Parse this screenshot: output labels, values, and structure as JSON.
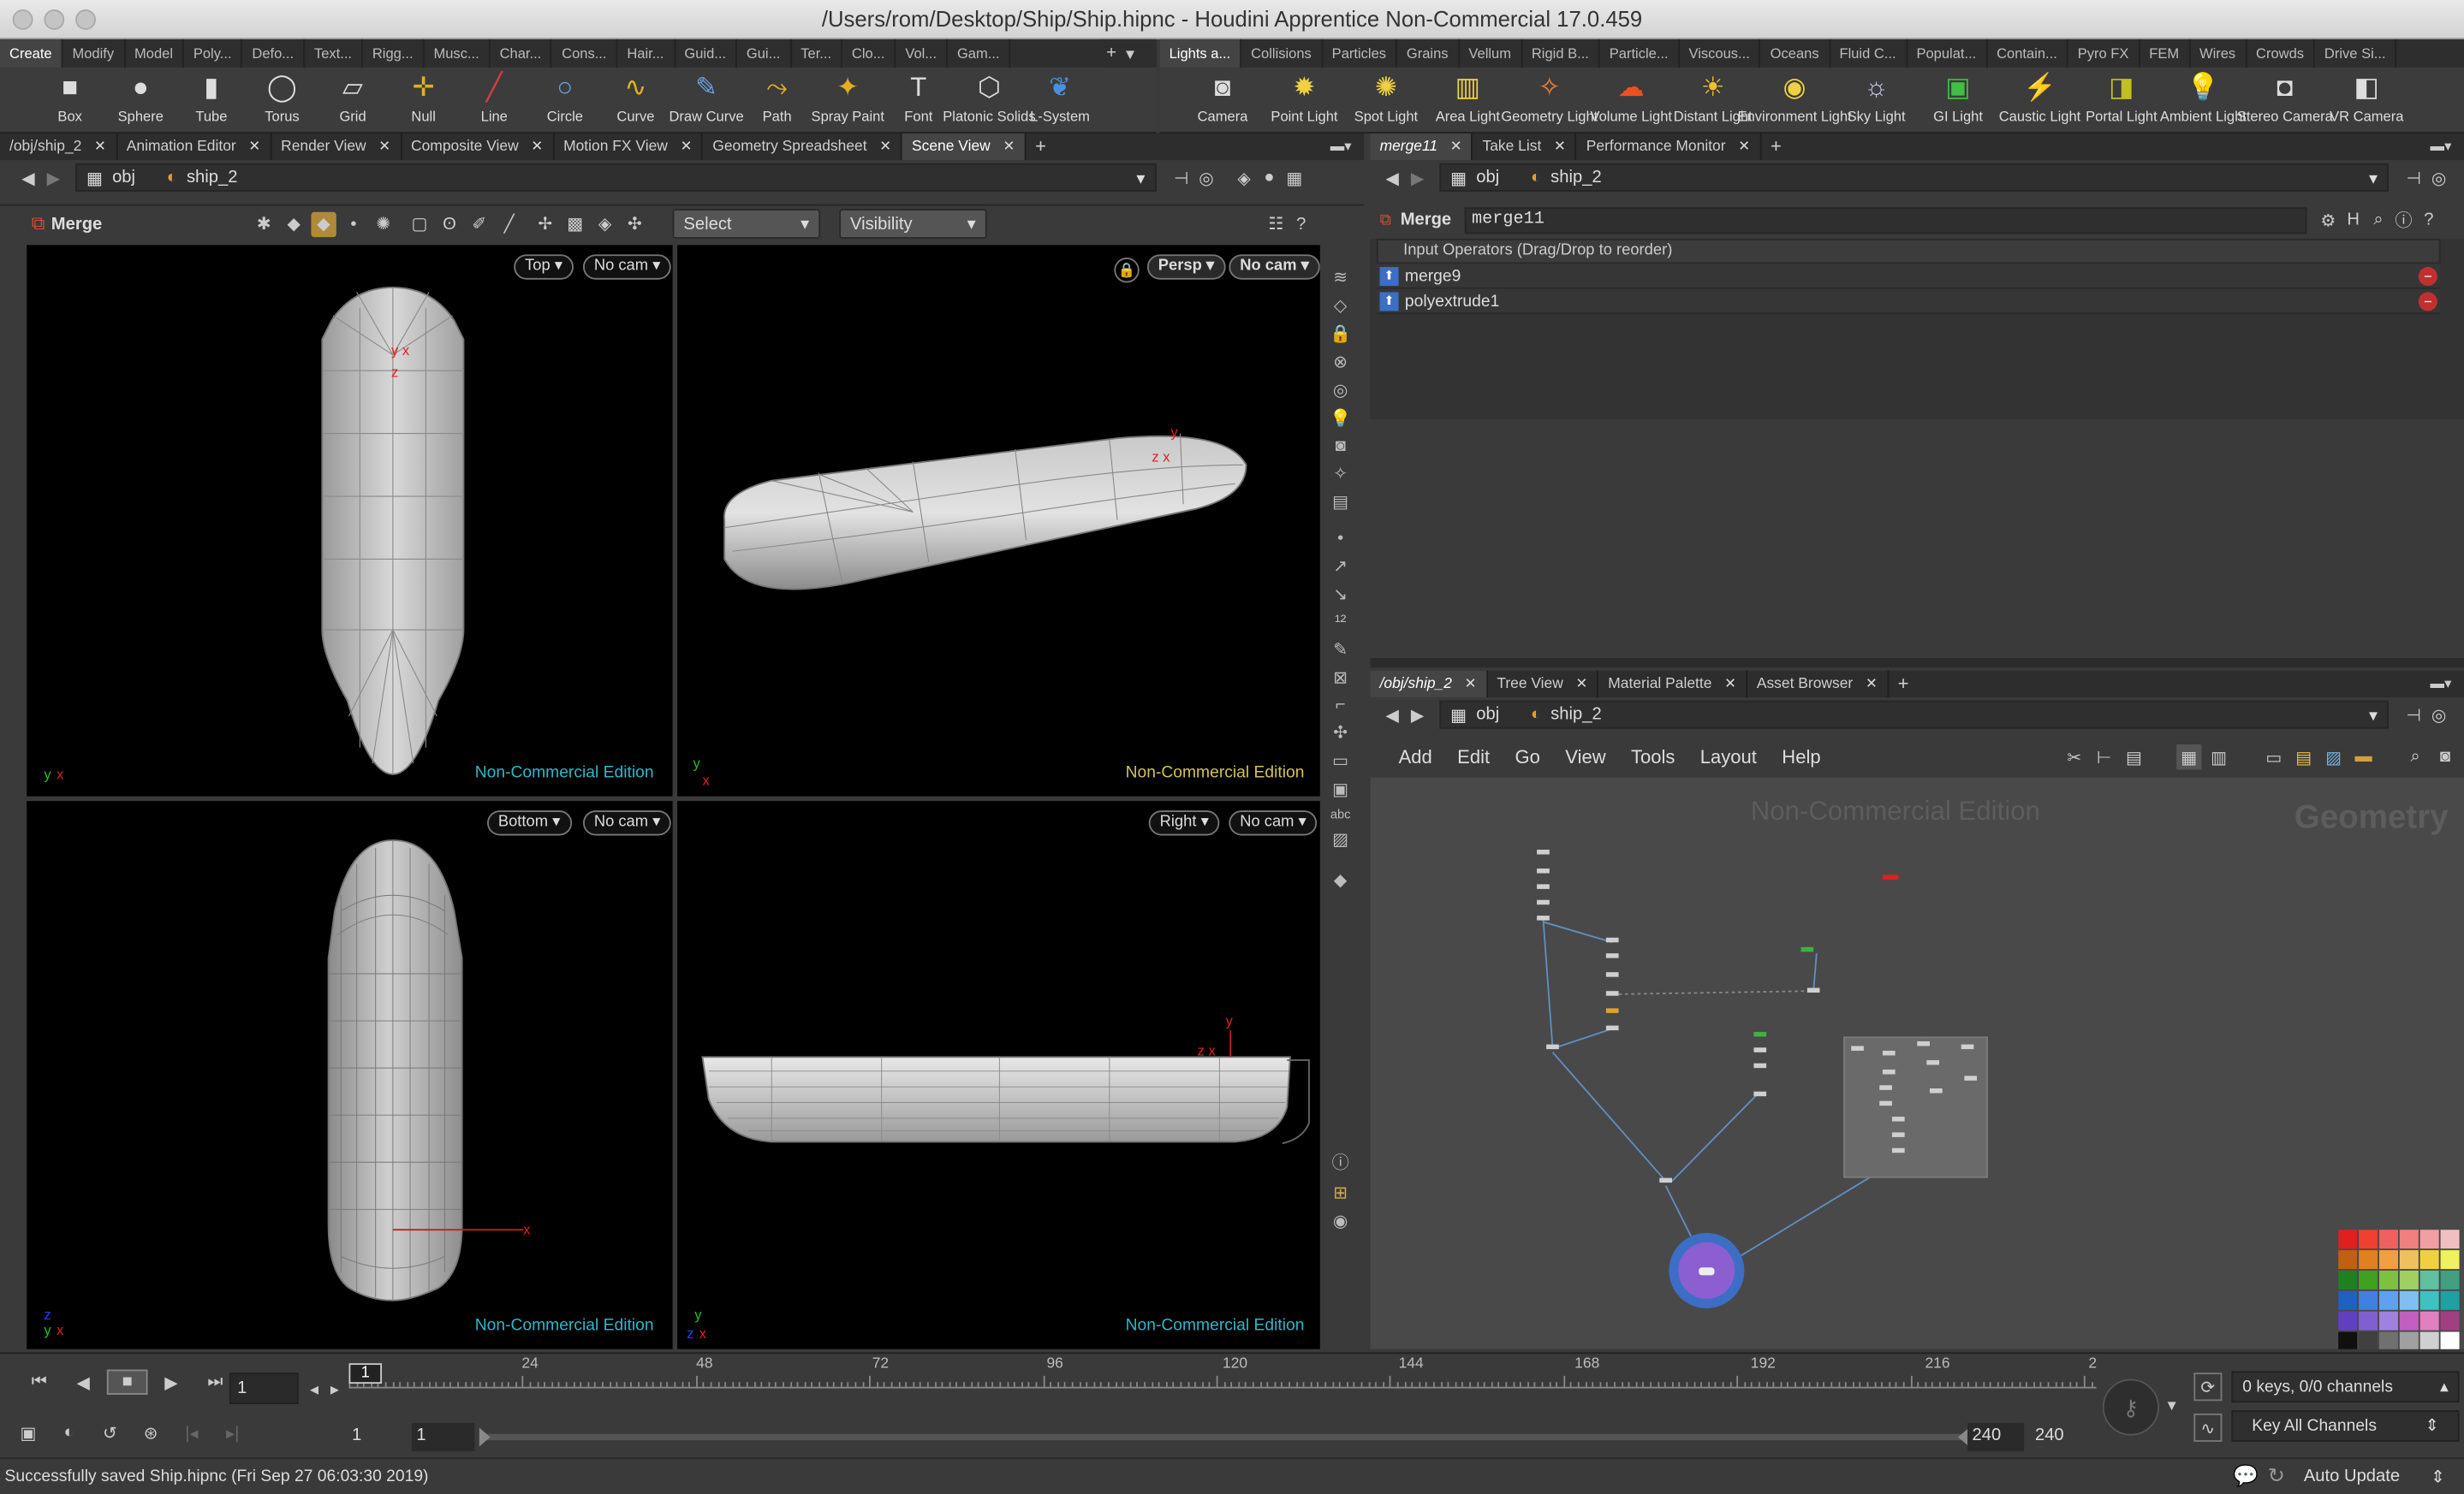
{
  "window": {
    "title": "/Users/rom/Desktop/Ship/Ship.hipnc - Houdini Apprentice Non-Commercial 17.0.459"
  },
  "shelf_left": {
    "tabs": [
      "Create",
      "Modify",
      "Model",
      "Poly...",
      "Defo...",
      "Text...",
      "Rigg...",
      "Musc...",
      "Char...",
      "Cons...",
      "Hair...",
      "Guid...",
      "Gui...",
      "Ter...",
      "Clo...",
      "Vol...",
      "Gam..."
    ],
    "active_tab": "Create",
    "tools": [
      {
        "label": "Box",
        "icon": "box-icon",
        "glyph": "■"
      },
      {
        "label": "Sphere",
        "icon": "sphere-icon",
        "glyph": "●"
      },
      {
        "label": "Tube",
        "icon": "tube-icon",
        "glyph": "▮"
      },
      {
        "label": "Torus",
        "icon": "torus-icon",
        "glyph": "◯"
      },
      {
        "label": "Grid",
        "icon": "grid-icon",
        "glyph": "▱"
      },
      {
        "label": "Null",
        "icon": "null-icon",
        "glyph": "✛"
      },
      {
        "label": "Line",
        "icon": "line-icon",
        "glyph": "╱"
      },
      {
        "label": "Circle",
        "icon": "circle-icon",
        "glyph": "○"
      },
      {
        "label": "Curve",
        "icon": "curve-icon",
        "glyph": "∿"
      },
      {
        "label": "Draw Curve",
        "icon": "draw-curve-icon",
        "glyph": "✎"
      },
      {
        "label": "Path",
        "icon": "path-icon",
        "glyph": "⤳"
      },
      {
        "label": "Spray Paint",
        "icon": "spray-paint-icon",
        "glyph": "✦"
      },
      {
        "label": "Font",
        "icon": "font-icon",
        "glyph": "T"
      },
      {
        "label": "Platonic Solids",
        "icon": "platonic-solids-icon",
        "glyph": "⬡"
      },
      {
        "label": "L-System",
        "icon": "l-system-icon",
        "glyph": "❦"
      }
    ]
  },
  "shelf_right": {
    "tabs": [
      "Lights a...",
      "Collisions",
      "Particles",
      "Grains",
      "Vellum",
      "Rigid B...",
      "Particle...",
      "Viscous...",
      "Oceans",
      "Fluid C...",
      "Populat...",
      "Contain...",
      "Pyro FX",
      "FEM",
      "Wires",
      "Crowds",
      "Drive Si..."
    ],
    "active_tab": "Lights a...",
    "tools": [
      {
        "label": "Camera",
        "icon": "camera-icon",
        "glyph": "◙"
      },
      {
        "label": "Point Light",
        "icon": "point-light-icon",
        "glyph": "✹"
      },
      {
        "label": "Spot Light",
        "icon": "spot-light-icon",
        "glyph": "✺"
      },
      {
        "label": "Area Light",
        "icon": "area-light-icon",
        "glyph": "▥"
      },
      {
        "label": "Geometry Light",
        "icon": "geometry-light-icon",
        "glyph": "✧"
      },
      {
        "label": "Volume Light",
        "icon": "volume-light-icon",
        "glyph": "☁"
      },
      {
        "label": "Distant Light",
        "icon": "distant-light-icon",
        "glyph": "☀"
      },
      {
        "label": "Environment Light",
        "icon": "environment-light-icon",
        "glyph": "◉"
      },
      {
        "label": "Sky Light",
        "icon": "sky-light-icon",
        "glyph": "☼"
      },
      {
        "label": "GI Light",
        "icon": "gi-light-icon",
        "glyph": "▣"
      },
      {
        "label": "Caustic Light",
        "icon": "caustic-light-icon",
        "glyph": "⚡"
      },
      {
        "label": "Portal Light",
        "icon": "portal-light-icon",
        "glyph": "◨"
      },
      {
        "label": "Ambient Light",
        "icon": "ambient-light-icon",
        "glyph": "💡"
      },
      {
        "label": "Stereo Camera",
        "icon": "stereo-camera-icon",
        "glyph": "◘"
      },
      {
        "label": "VR Camera",
        "icon": "vr-camera-icon",
        "glyph": "◧"
      }
    ]
  },
  "left_pane": {
    "tabs": [
      "/obj/ship_2",
      "Animation Editor",
      "Render View",
      "Composite View",
      "Motion FX View",
      "Geometry Spreadsheet",
      "Scene View"
    ],
    "active_tab": "Scene View",
    "path": {
      "root": "obj",
      "node": "ship_2"
    },
    "toolbar": {
      "node_label": "Merge",
      "select_label": "Select",
      "visibility_label": "Visibility"
    },
    "viewports": [
      {
        "view": "Top",
        "cam": "No cam",
        "watermark": "Non-Commercial Edition"
      },
      {
        "view": "Persp",
        "cam": "No cam",
        "watermark": "Non-Commercial Edition"
      },
      {
        "view": "Bottom",
        "cam": "No cam",
        "watermark": "Non-Commercial Edition"
      },
      {
        "view": "Right",
        "cam": "No cam",
        "watermark": "Non-Commercial Edition"
      }
    ]
  },
  "param_pane": {
    "tabs": [
      "merge11",
      "Take List",
      "Performance Monitor"
    ],
    "active_tab": "merge11",
    "path": {
      "root": "obj",
      "node": "ship_2"
    },
    "node_type": "Merge",
    "node_name": "merge11",
    "input_header": "Input Operators (Drag/Drop to reorder)",
    "inputs": [
      "merge9",
      "polyextrude1"
    ]
  },
  "network_pane": {
    "tabs": [
      "/obj/ship_2",
      "Tree View",
      "Material Palette",
      "Asset Browser"
    ],
    "active_tab": "/obj/ship_2",
    "path": {
      "root": "obj",
      "node": "ship_2"
    },
    "menu": [
      "Add",
      "Edit",
      "Go",
      "View",
      "Tools",
      "Layout",
      "Help"
    ],
    "watermark": "Non-Commercial Edition",
    "context_label": "Geometry"
  },
  "timeline": {
    "current_frame": "1",
    "ticks": [
      "1",
      "24",
      "48",
      "72",
      "96",
      "120",
      "144",
      "168",
      "192",
      "216",
      "2"
    ],
    "range_start": "1",
    "range_start2": "1",
    "range_end": "240",
    "range_end2": "240",
    "keys_label": "0 keys, 0/0 channels",
    "key_all_label": "Key All Channels"
  },
  "status": {
    "message": "Successfully saved Ship.hipnc (Fri Sep 27 06:03:30 2019)",
    "auto_update": "Auto Update"
  },
  "colors": {
    "watermark_cyan": "#2fb7c8",
    "watermark_yellow": "#d2c15a",
    "display_node": "#8b5fd0"
  }
}
